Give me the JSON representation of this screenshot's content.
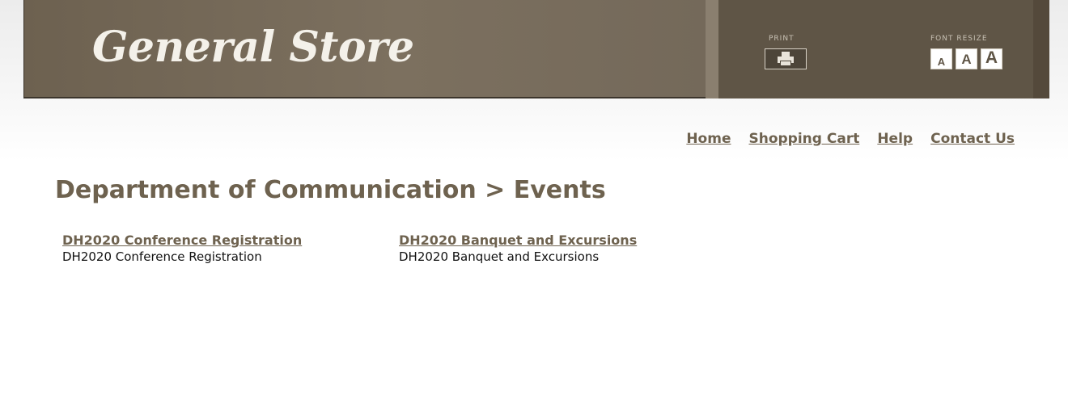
{
  "header": {
    "brand_title": "General Store",
    "print_label": "PRINT",
    "font_resize_label": "FONT RESIZE",
    "resize_buttons": [
      "A",
      "A",
      "A"
    ]
  },
  "nav": {
    "items": [
      "Home",
      "Shopping Cart",
      "Help",
      "Contact Us"
    ]
  },
  "page": {
    "heading": "Department of Communication > Events"
  },
  "events": [
    {
      "title": "DH2020 Conference Registration",
      "description": "DH2020 Conference Registration"
    },
    {
      "title": "DH2020 Banquet and Excursions",
      "description": "DH2020 Banquet and Excursions"
    }
  ],
  "colors": {
    "brand_bg": "#7c705f",
    "tools_bg": "#5f5546",
    "link": "#6e624f",
    "heading": "#6e624f"
  },
  "icons": {
    "print": "printer-icon"
  }
}
